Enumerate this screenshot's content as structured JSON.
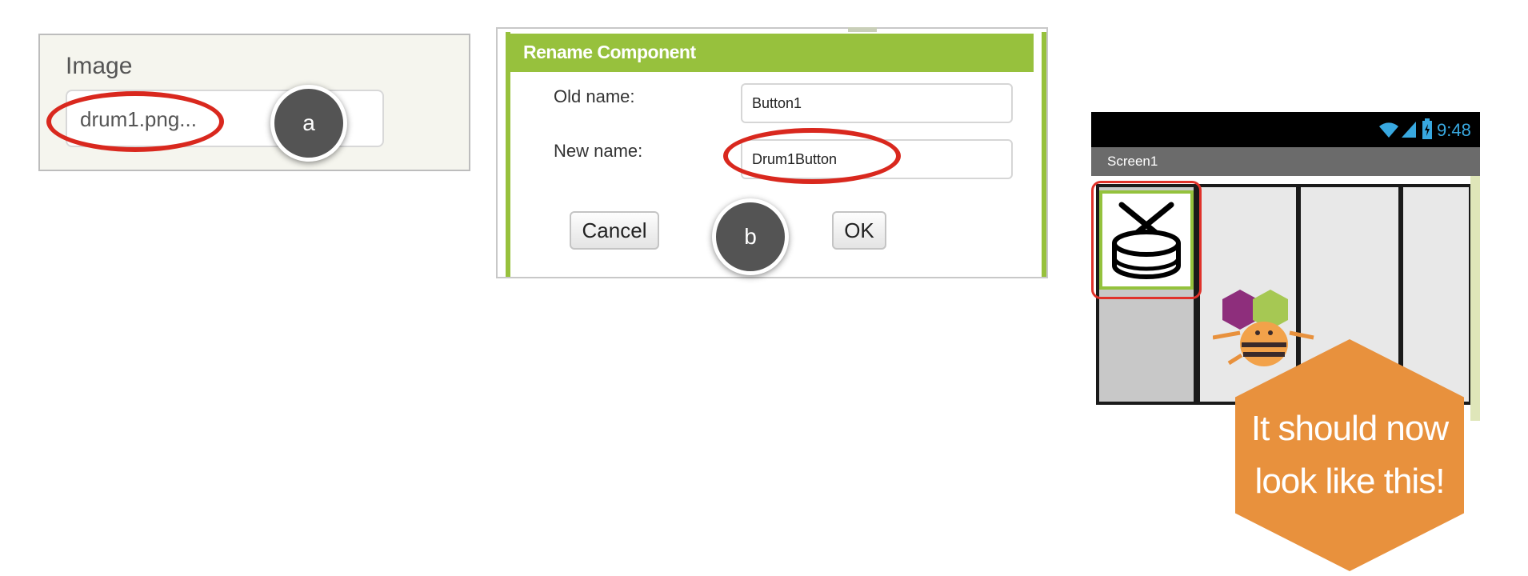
{
  "image_property": {
    "label": "Image",
    "value": "drum1.png..."
  },
  "rename_dialog": {
    "title": "Rename Component",
    "old_name_label": "Old name:",
    "old_name_value": "Button1",
    "new_name_label": "New name:",
    "new_name_value": "Drum1Button",
    "cancel_label": "Cancel",
    "ok_label": "OK"
  },
  "callouts": {
    "a": "a",
    "b": "b"
  },
  "phone": {
    "status_time": "9:48",
    "screen_title": "Screen1",
    "button_icon": "drum-icon",
    "mascot_icon": "app-inventor-bee-icon"
  },
  "hint": {
    "line1": "It should now",
    "line2": "look like this!"
  },
  "colors": {
    "header_green": "#97c13d",
    "highlight_red": "#d9281e",
    "hexagon_orange": "#e8913d",
    "bubble_gray": "#545454",
    "status_blue": "#38a8e0"
  }
}
